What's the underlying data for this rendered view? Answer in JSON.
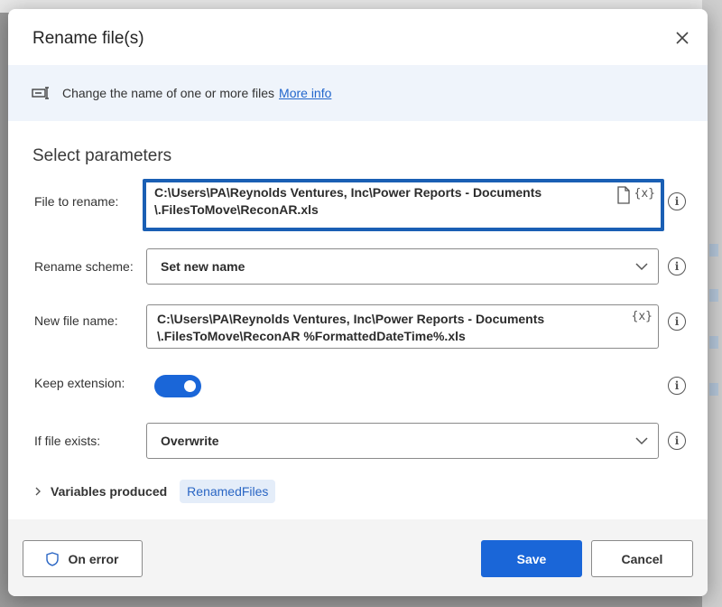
{
  "dialog": {
    "title": "Rename file(s)",
    "banner_text": "Change the name of one or more files",
    "banner_link": "More info",
    "section_title": "Select parameters"
  },
  "fields": {
    "file_to_rename": {
      "label": "File to rename:",
      "line1": "C:\\Users\\PA\\Reynolds Ventures, Inc\\Power Reports - Documents",
      "line2": "\\.FilesToMove\\ReconAR.xls"
    },
    "rename_scheme": {
      "label": "Rename scheme:",
      "value": "Set new name"
    },
    "new_file_name": {
      "label": "New file name:",
      "line1": "C:\\Users\\PA\\Reynolds Ventures, Inc\\Power Reports - Documents",
      "line2": "\\.FilesToMove\\ReconAR %FormattedDateTime%.xls"
    },
    "keep_extension": {
      "label": "Keep extension:",
      "enabled": true
    },
    "if_file_exists": {
      "label": "If file exists:",
      "value": "Overwrite"
    }
  },
  "variables": {
    "label": "Variables produced",
    "chip": "RenamedFiles"
  },
  "footer": {
    "on_error": "On error",
    "save": "Save",
    "cancel": "Cancel"
  },
  "icons": {
    "variable_picker": "{x}",
    "info": "i"
  },
  "colors": {
    "accent": "#1a66d8",
    "highlight_border": "#1a5fb4",
    "banner_bg": "#eff4fb",
    "link": "#2266cc"
  }
}
